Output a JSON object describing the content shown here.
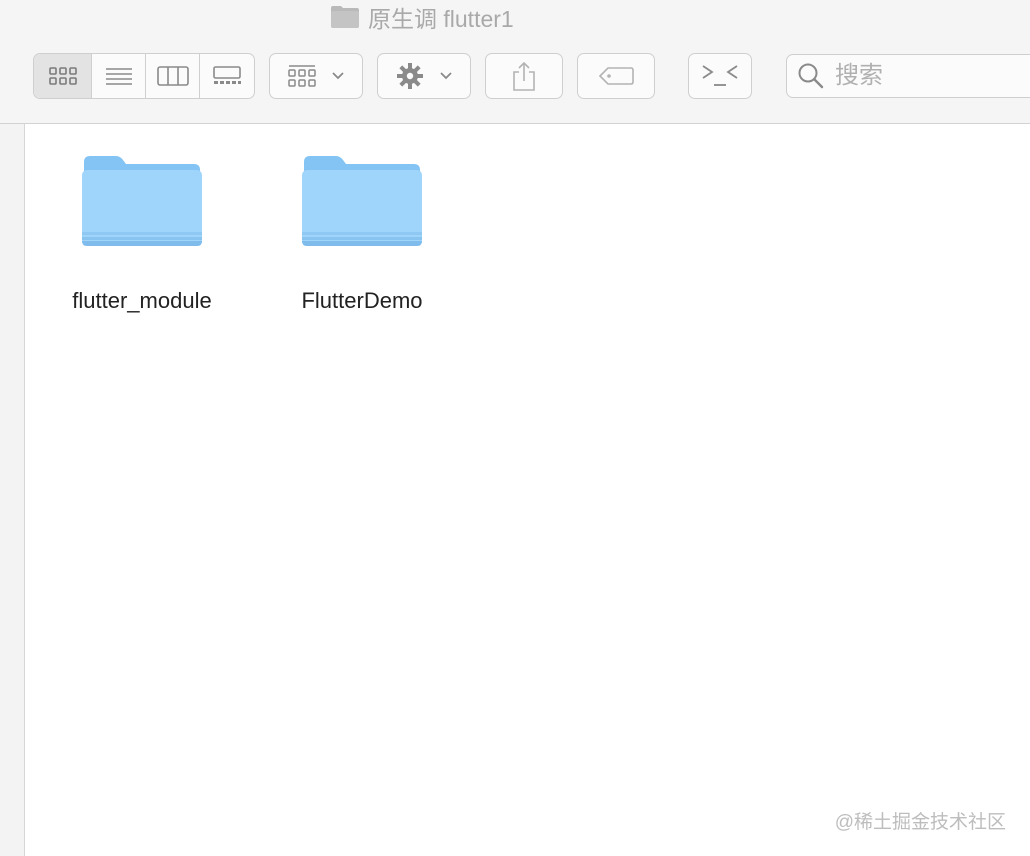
{
  "window": {
    "title": "原生调 flutter1",
    "title_icon": "folder-icon"
  },
  "toolbar": {
    "view_modes": [
      {
        "icon": "icon-view-icon",
        "active": true
      },
      {
        "icon": "list-view-icon",
        "active": false
      },
      {
        "icon": "column-view-icon",
        "active": false
      },
      {
        "icon": "gallery-view-icon",
        "active": false
      }
    ],
    "group_button_icon": "group-grid-icon",
    "action_button_icon": "gear-icon",
    "share_button_icon": "share-icon",
    "tag_button_icon": "tag-icon",
    "terminal_button_icon": "terminal-icon"
  },
  "search": {
    "placeholder": "搜索",
    "value": ""
  },
  "content": {
    "items": [
      {
        "name": "flutter_module",
        "type": "folder",
        "icon": "folder-icon"
      },
      {
        "name": "FlutterDemo",
        "type": "folder",
        "icon": "folder-icon"
      }
    ]
  },
  "watermark": {
    "text": "@稀土掘金技术社区"
  },
  "colors": {
    "folder_light": "#9fd4fb",
    "folder_dark": "#78bff2",
    "toolbar_bg": "#f5f5f5",
    "icon_gray": "#8a8a8a",
    "title_gray": "#a9a9a9"
  }
}
